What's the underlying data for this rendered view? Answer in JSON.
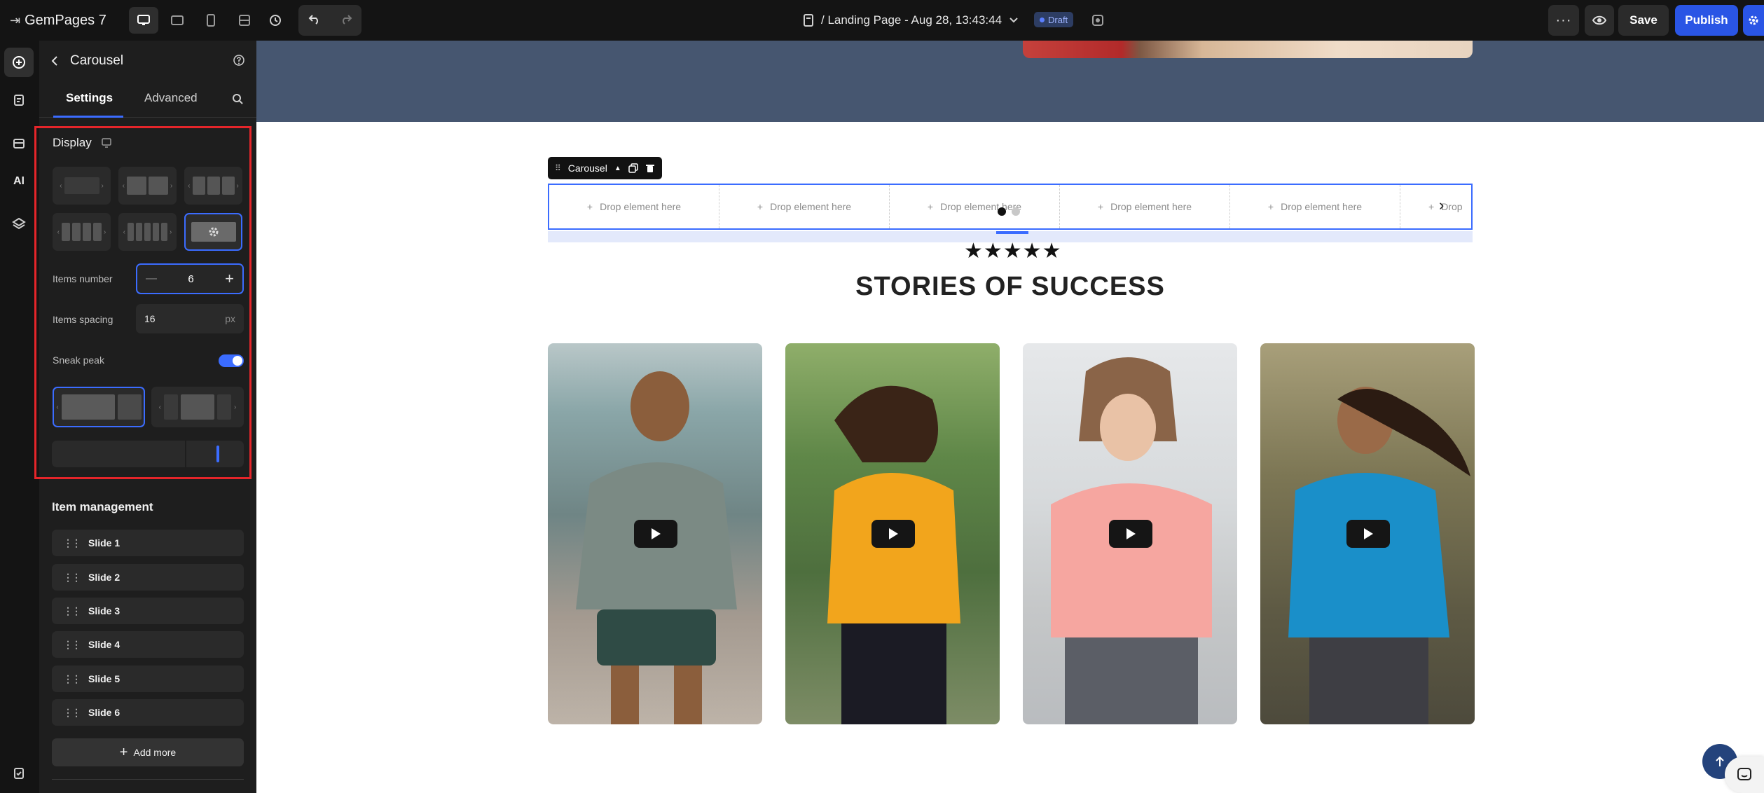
{
  "app": {
    "name": "GemPages 7"
  },
  "topbar": {
    "page_title": "/ Landing Page - Aug 28, 13:43:44",
    "status": "Draft",
    "save_label": "Save",
    "publish_label": "Publish",
    "devices": [
      "desktop-icon",
      "tablet-landscape-icon",
      "mobile-icon",
      "responsive-icon"
    ]
  },
  "panel": {
    "title": "Carousel",
    "tabs": [
      "Settings",
      "Advanced"
    ],
    "display_title": "Display",
    "items_number_label": "Items number",
    "items_number_value": "6",
    "items_spacing_label": "Items spacing",
    "items_spacing_value": "16",
    "items_spacing_unit": "px",
    "sneak_peak_label": "Sneak peak",
    "sneak_peak_on": true,
    "item_management_title": "Item management",
    "slides": [
      "Slide 1",
      "Slide 2",
      "Slide 3",
      "Slide 4",
      "Slide 5",
      "Slide 6"
    ],
    "add_more_label": "Add more"
  },
  "canvas": {
    "carousel_tag": "Carousel",
    "drop_cells": [
      "Drop element here",
      "Drop element here",
      "Drop element here",
      "Drop element here",
      "Drop element here",
      "Drop"
    ],
    "stars": "★★★★★",
    "heading": "STORIES OF SUCCESS",
    "dots_count": 2,
    "active_dot": 0
  },
  "colors": {
    "accent": "#3b6cff",
    "highlight": "#e5252a",
    "hero": "#465670"
  }
}
